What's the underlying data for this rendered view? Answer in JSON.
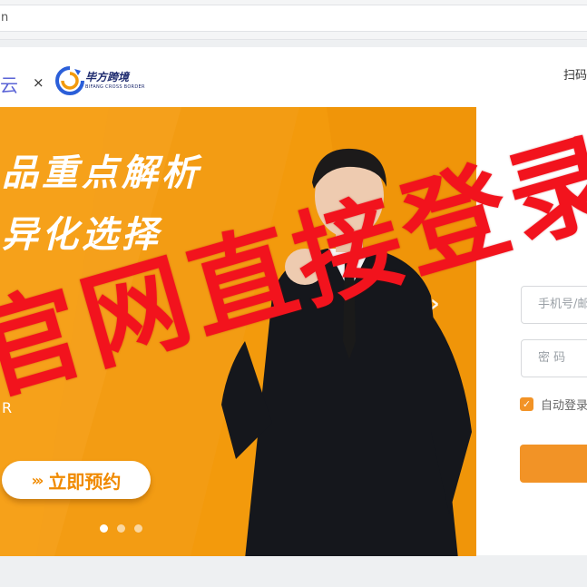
{
  "browser": {
    "url_fragment": "n"
  },
  "header": {
    "brand_left": "云",
    "separator": "×",
    "partner_name": "毕方跨境",
    "partner_sub": "BIFANG CROSS BORDER",
    "scan_link": "扫码"
  },
  "banner": {
    "headline_1": "品重点解析",
    "headline_2": "异化选择",
    "tagline_fragment": "R",
    "cta_label": "立即预约",
    "cta_icon": "chevrons-right-icon",
    "next_icon": "chevron-right-icon",
    "slide_count": 3,
    "active_slide": 1
  },
  "watermark": {
    "text": "官网直接登录"
  },
  "login": {
    "phone_placeholder": "手机号/邮",
    "password_placeholder": "密 码",
    "remember_label": "自动登录",
    "remember_checked": true
  },
  "colors": {
    "banner_orange": "#f39a0c",
    "accent": "#f29326",
    "watermark_red": "#f2131d"
  }
}
